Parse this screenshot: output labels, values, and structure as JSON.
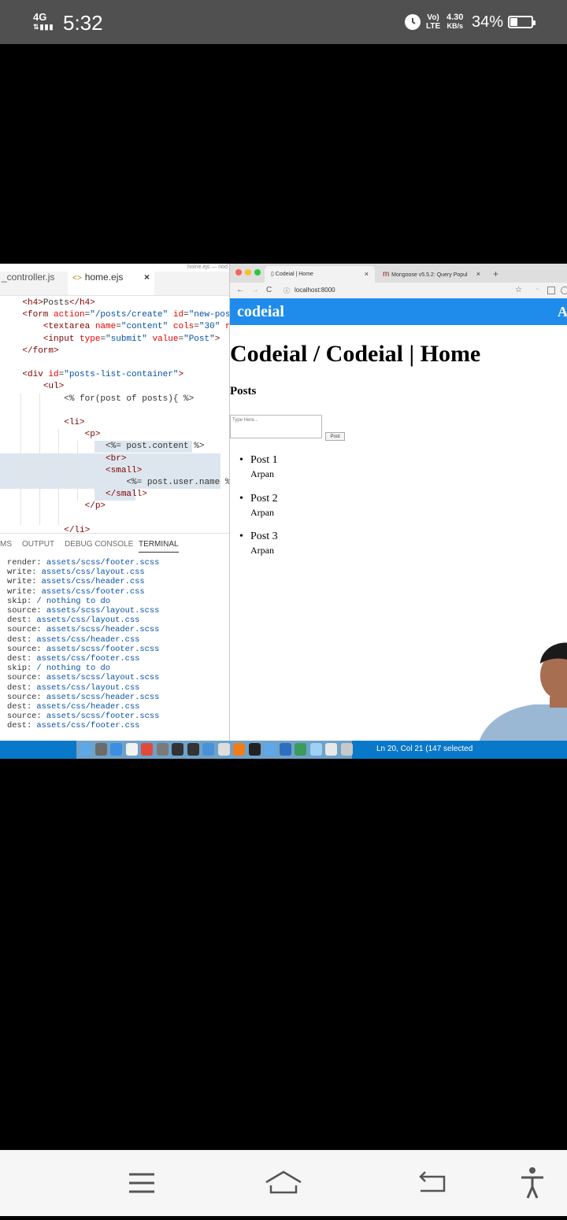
{
  "status_bar": {
    "network": "4G",
    "time": "5:32",
    "volte_top": "Vo)",
    "volte_bottom": "LTE",
    "speed_value": "4.30",
    "speed_unit": "KB/s",
    "battery_percent": "34%",
    "battery_level": 0.34
  },
  "vscode": {
    "window_title": "home.ejs — nod",
    "tabs": [
      {
        "label": "_controller.js",
        "active": false
      },
      {
        "label": "home.ejs",
        "active": true
      }
    ],
    "tab_close_glyph": "×",
    "code_lines": [
      {
        "indent": "    ",
        "parts": [
          [
            "tag",
            "<h4>"
          ],
          [
            "txt",
            "Posts"
          ],
          [
            "tag",
            "</h4>"
          ]
        ]
      },
      {
        "indent": "    ",
        "parts": [
          [
            "tag",
            "<form "
          ],
          [
            "attr",
            "action"
          ],
          [
            "txt",
            "="
          ],
          [
            "str",
            "\"/posts/create\""
          ],
          [
            "txt",
            " "
          ],
          [
            "attr",
            "id"
          ],
          [
            "txt",
            "="
          ],
          [
            "str",
            "\"new-post-fo"
          ]
        ]
      },
      {
        "indent": "        ",
        "parts": [
          [
            "tag",
            "<textarea "
          ],
          [
            "attr",
            "name"
          ],
          [
            "txt",
            "="
          ],
          [
            "str",
            "\"content\""
          ],
          [
            "txt",
            " "
          ],
          [
            "attr",
            "cols"
          ],
          [
            "txt",
            "="
          ],
          [
            "str",
            "\"30\""
          ],
          [
            "txt",
            " "
          ],
          [
            "attr",
            "rows"
          ],
          [
            "txt",
            "="
          ]
        ]
      },
      {
        "indent": "        ",
        "parts": [
          [
            "tag",
            "<input "
          ],
          [
            "attr",
            "type"
          ],
          [
            "txt",
            "="
          ],
          [
            "str",
            "\"submit\""
          ],
          [
            "txt",
            " "
          ],
          [
            "attr",
            "value"
          ],
          [
            "txt",
            "="
          ],
          [
            "str",
            "\"Post\""
          ],
          [
            "tag",
            ">"
          ]
        ]
      },
      {
        "indent": "    ",
        "parts": [
          [
            "tag",
            "</form>"
          ]
        ]
      },
      {
        "indent": "",
        "parts": []
      },
      {
        "indent": "    ",
        "parts": [
          [
            "tag",
            "<div "
          ],
          [
            "attr",
            "id"
          ],
          [
            "txt",
            "="
          ],
          [
            "str",
            "\"posts-list-container\""
          ],
          [
            "tag",
            ">"
          ]
        ]
      },
      {
        "indent": "        ",
        "parts": [
          [
            "tag",
            "<ul>"
          ]
        ]
      },
      {
        "indent": "            ",
        "parts": [
          [
            "txt",
            "<% for(post of posts){ %>"
          ]
        ]
      },
      {
        "indent": "",
        "parts": []
      },
      {
        "indent": "            ",
        "parts": [
          [
            "tag",
            "<li>"
          ]
        ]
      },
      {
        "indent": "                ",
        "parts": [
          [
            "tag",
            "<p>"
          ]
        ]
      },
      {
        "indent": "                    ",
        "parts": [
          [
            "txt",
            "<%= post.content %>"
          ]
        ]
      },
      {
        "indent": "                    ",
        "parts": [
          [
            "tag",
            "<br>"
          ]
        ]
      },
      {
        "indent": "                    ",
        "parts": [
          [
            "tag",
            "<small>"
          ]
        ]
      },
      {
        "indent": "                        ",
        "parts": [
          [
            "txt",
            "<%= post.user.name %>"
          ]
        ]
      },
      {
        "indent": "                    ",
        "parts": [
          [
            "tag",
            "</small>"
          ]
        ]
      },
      {
        "indent": "                ",
        "parts": [
          [
            "tag",
            "</p>"
          ]
        ]
      },
      {
        "indent": "",
        "parts": []
      },
      {
        "indent": "            ",
        "parts": [
          [
            "tag",
            "</li>"
          ]
        ]
      }
    ],
    "panel_tabs": [
      "MS",
      "OUTPUT",
      "DEBUG CONSOLE",
      "TERMINAL"
    ],
    "terminal_lines": [
      {
        "label": "render:",
        "path": "assets/scss/footer.scss"
      },
      {
        "label": "write:",
        "path": "assets/css/layout.css"
      },
      {
        "label": "write:",
        "path": "assets/css/header.css"
      },
      {
        "label": "write:",
        "path": "assets/css/footer.css"
      },
      {
        "label": "skip:",
        "path": "/ nothing to do"
      },
      {
        "label": "source:",
        "path": "assets/scss/layout.scss"
      },
      {
        "label": "dest:",
        "path": "assets/css/layout.css"
      },
      {
        "label": "source:",
        "path": "assets/scss/header.scss"
      },
      {
        "label": "dest:",
        "path": "assets/css/header.css"
      },
      {
        "label": "source:",
        "path": "assets/scss/footer.scss"
      },
      {
        "label": "dest:",
        "path": "assets/css/footer.css"
      },
      {
        "label": "skip:",
        "path": "/ nothing to do"
      },
      {
        "label": "source:",
        "path": "assets/scss/layout.scss"
      },
      {
        "label": "dest:",
        "path": "assets/css/layout.css"
      },
      {
        "label": "source:",
        "path": "assets/scss/header.scss"
      },
      {
        "label": "dest:",
        "path": "assets/css/header.css"
      },
      {
        "label": "source:",
        "path": "assets/scss/footer.scss"
      },
      {
        "label": "dest:",
        "path": "assets/css/footer.css"
      }
    ],
    "status_text": "Ln 20, Col 21 (147 selected"
  },
  "browser": {
    "tabs": [
      {
        "label": "Codeial | Home",
        "close": "×"
      },
      {
        "label": "Mongoose v5.5.2: Query Popul",
        "close": "×"
      }
    ],
    "new_tab": "+",
    "url": "localhost:8000",
    "nav_icons": {
      "back": "←",
      "forward": "→",
      "reload": "C",
      "info": "ⓘ",
      "star": "☆"
    },
    "site": {
      "brand": "codeial",
      "nav_right": "A",
      "heading": "Codeial / Codeial | Home",
      "subheading": "Posts",
      "textarea_placeholder": "Type Here...",
      "post_button": "Post",
      "posts": [
        {
          "content": "Post 1",
          "author": "Arpan"
        },
        {
          "content": "Post 2",
          "author": "Arpan"
        },
        {
          "content": "Post 3",
          "author": "Arpan"
        }
      ]
    }
  },
  "colors": {
    "status_bar_bg": "#505050",
    "site_nav_bg": "#1f8ceb",
    "vscode_status_bg": "#0a78c8",
    "selection_bg": "#dde6ee"
  },
  "dock_icons": [
    "finder-icon",
    "launchpad-icon",
    "safari-icon",
    "notes-icon",
    "chrome-icon",
    "preferences-icon",
    "compass-icon",
    "obs-icon",
    "download-icon",
    "preview-icon",
    "sublime-icon",
    "terminal-icon",
    "help-icon",
    "vscode-icon",
    "android-studio-icon",
    "folder-icon",
    "monitor-icon",
    "trash-icon"
  ]
}
